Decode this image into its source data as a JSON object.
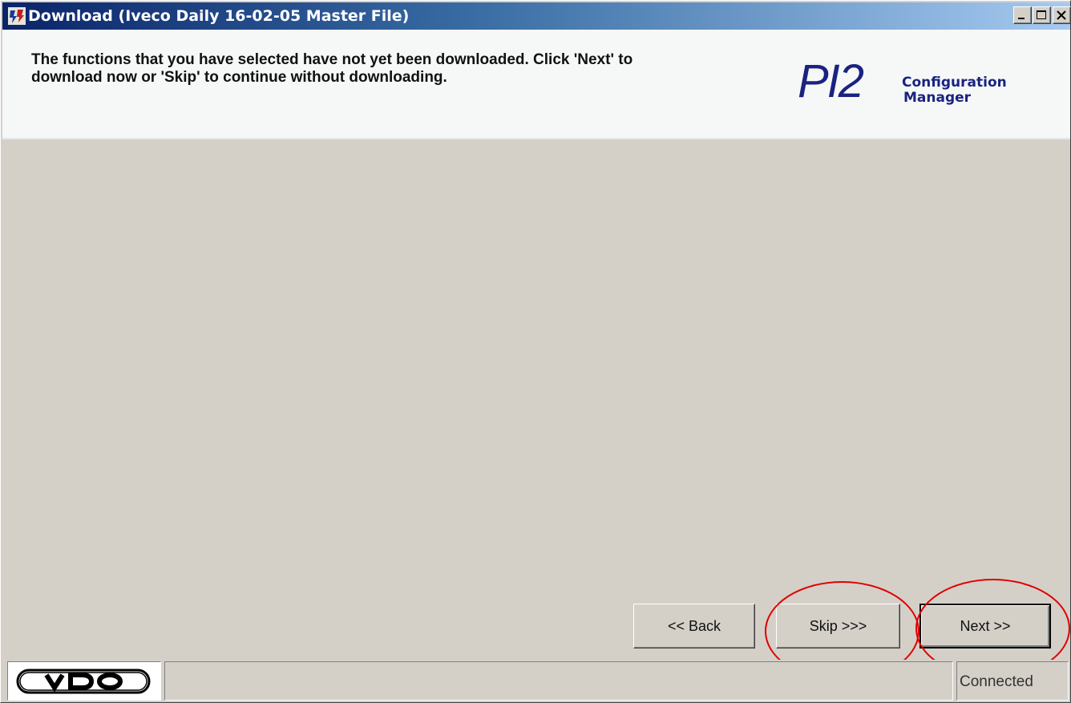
{
  "window": {
    "title": "Download (Iveco Daily 16-02-05 Master File)"
  },
  "header": {
    "instructions": "The functions that you have selected have not yet been downloaded. Click 'Next' to download now or 'Skip' to continue without downloading.",
    "logo_main": "PI2",
    "logo_line1": "Configuration",
    "logo_line2": "Manager"
  },
  "buttons": {
    "back": "<< Back",
    "skip": "Skip >>>",
    "next": "Next >>"
  },
  "statusbar": {
    "brand_logo": "VDO",
    "connection_status": "Connected"
  },
  "colors": {
    "annotation_circle": "#e00000",
    "logo_blue": "#1a2380",
    "titlebar_start": "#0a246a",
    "titlebar_end": "#a6caf0"
  }
}
